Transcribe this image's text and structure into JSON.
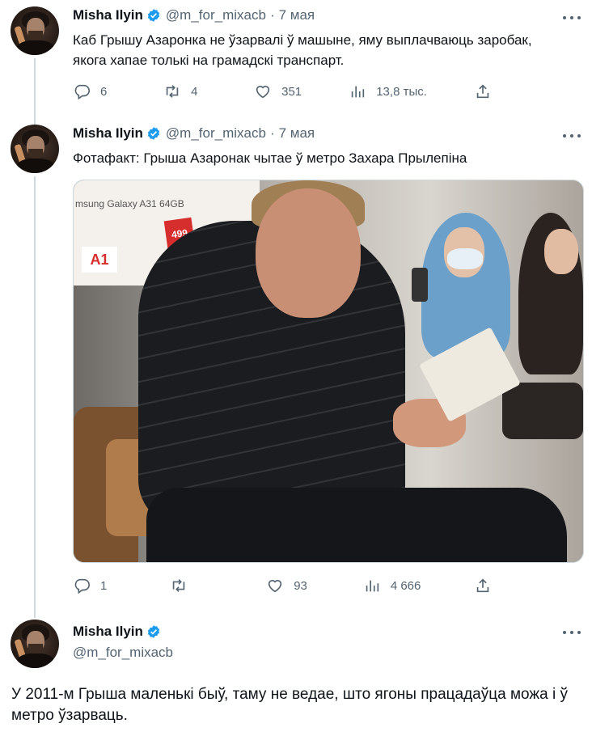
{
  "tweets": [
    {
      "name": "Misha Ilyin",
      "handle": "@m_for_mixacb",
      "date": "7 мая",
      "text": "Каб Грышу Азаронка не ўзарвалі ў машыне, яму выплачваюць заробак, якога хапае толькі на грамадскі транспарт.",
      "replies": "6",
      "retweets": "4",
      "likes": "351",
      "views": "13,8 тыс."
    },
    {
      "name": "Misha Ilyin",
      "handle": "@m_for_mixacb",
      "date": "7 мая",
      "text": "Фотафакт: Грыша Азаронак чытае ў метро Захара Прылепіна",
      "photo_ad_text": "msung Galaxy A31 64GB",
      "photo_price": "499",
      "photo_logo": "A1",
      "replies": "1",
      "retweets": "",
      "likes": "93",
      "views": "4 666"
    },
    {
      "name": "Misha Ilyin",
      "handle": "@m_for_mixacb",
      "text": "У 2011-м Грыша маленькі быў, таму не ведае, што ягоны працадаўца можа і ў метро ўзарваць."
    }
  ],
  "colors": {
    "verified": "#1d9bf0",
    "secondary_text": "#536471",
    "thread_line": "#cfd9de"
  },
  "icons": [
    "reply-icon",
    "retweet-icon",
    "like-icon",
    "views-icon",
    "share-icon",
    "more-icon",
    "verified-badge-icon"
  ]
}
